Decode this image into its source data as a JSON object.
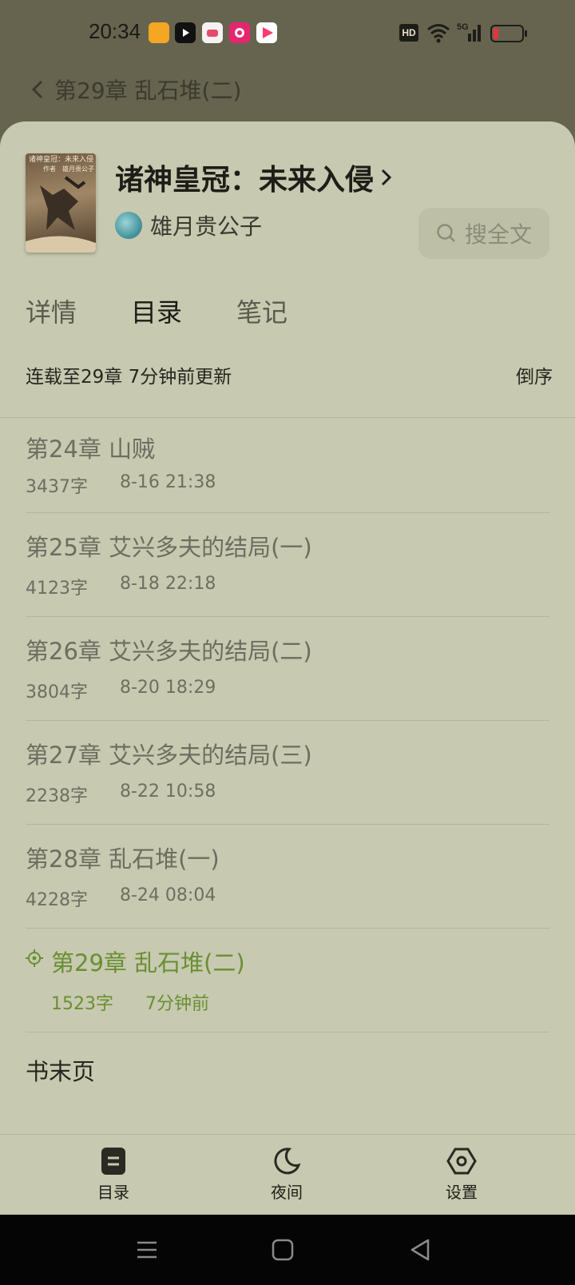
{
  "status": {
    "time": "20:34",
    "app_icons": [
      "taobao-icon",
      "tiktok-icon",
      "game-icon",
      "camera-app-icon",
      "video-app-icon"
    ],
    "hd": "HD",
    "network": "5G",
    "battery_level": 0.12
  },
  "reader": {
    "chapter_title": "第29章 乱石堆(二)"
  },
  "book": {
    "cover_text_line1": "诸神皇冠：未来入侵",
    "cover_text_line2": "作者　雄月贵公子",
    "title": "诸神皇冠：未来入侵",
    "author": "雄月贵公子",
    "search_label": "搜全文"
  },
  "tabs": [
    {
      "label": "详情"
    },
    {
      "label": "目录"
    },
    {
      "label": "笔记"
    }
  ],
  "summary": {
    "status_text": "连载至29章 7分钟前更新",
    "sort_label": "倒序"
  },
  "chapters": [
    {
      "title": "第24章 山贼",
      "words": "3437字",
      "time": "8-16 21:38"
    },
    {
      "title": "第25章 艾兴多夫的结局(一)",
      "words": "4123字",
      "time": "8-18 22:18"
    },
    {
      "title": "第26章 艾兴多夫的结局(二)",
      "words": "3804字",
      "time": "8-20 18:29"
    },
    {
      "title": "第27章 艾兴多夫的结局(三)",
      "words": "2238字",
      "time": "8-22 10:58"
    },
    {
      "title": "第28章 乱石堆(一)",
      "words": "4228字",
      "time": "8-24 08:04"
    },
    {
      "title": "第29章 乱石堆(二)",
      "words": "1523字",
      "time": "7分钟前",
      "current": true
    }
  ],
  "end_page": "书末页",
  "bottom_bar": {
    "toc": "目录",
    "night": "夜间",
    "settings": "设置"
  },
  "colors": {
    "sheet_bg": "#c7c9b0",
    "overlay_bg": "#66644f",
    "current_chapter": "#6a8f33"
  }
}
